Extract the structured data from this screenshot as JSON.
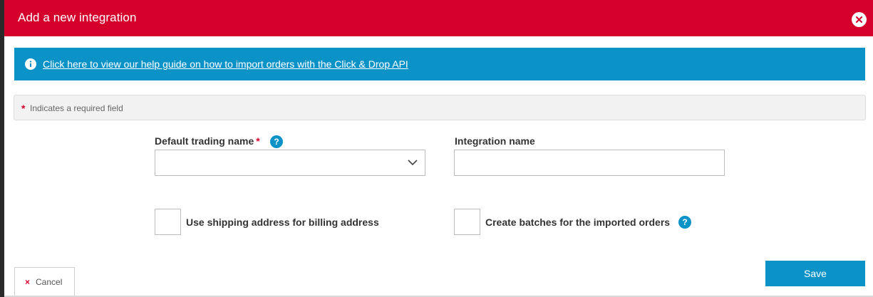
{
  "modal": {
    "title": "Add a new integration",
    "close_icon": "close-icon"
  },
  "banner": {
    "icon": "info-icon",
    "link_text": "Click here to view our help guide on how to import orders with the Click & Drop API"
  },
  "required_note": {
    "star": "*",
    "text": "Indicates a required field"
  },
  "form": {
    "trading_name": {
      "label": "Default trading name",
      "required_star": "*",
      "help": "?",
      "value": ""
    },
    "integration_name": {
      "label": "Integration name",
      "value": ""
    },
    "shipping_billing": {
      "label": "Use shipping address for billing address",
      "checked": false
    },
    "create_batches": {
      "label": "Create batches for the imported orders",
      "help": "?",
      "checked": false
    }
  },
  "footer": {
    "cancel_icon": "×",
    "cancel_label": "Cancel",
    "save_label": "Save"
  },
  "colors": {
    "header_red": "#d4002b",
    "accent_blue": "#0b93c8"
  }
}
